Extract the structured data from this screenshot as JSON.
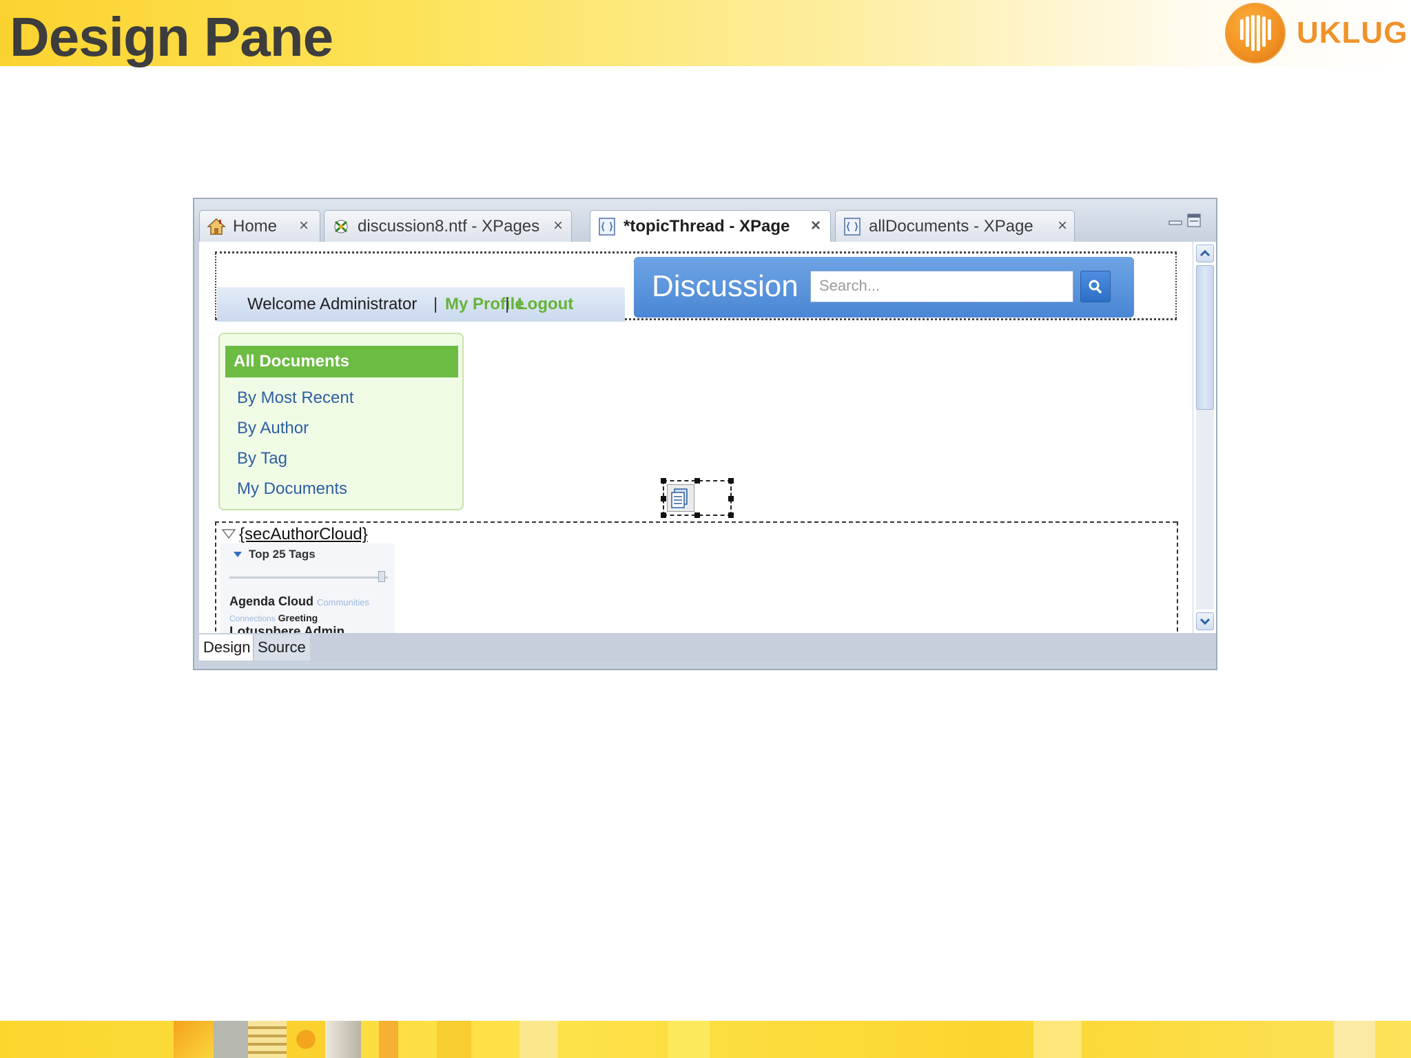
{
  "slide": {
    "title": "Design Pane",
    "logo_text": "UKLUG",
    "brand_color": "#f0922a"
  },
  "editor": {
    "tabs": [
      {
        "label": "Home",
        "icon": "home-icon",
        "active": false
      },
      {
        "label": "discussion8.ntf - XPages",
        "icon": "xpages-app-icon",
        "active": false
      },
      {
        "label": "*topicThread - XPage",
        "icon": "xpage-icon",
        "active": true
      },
      {
        "label": "allDocuments - XPage",
        "icon": "xpage-icon",
        "active": false
      }
    ],
    "close_glyph": "×",
    "bottom_tabs": {
      "design": "Design",
      "source": "Source"
    }
  },
  "design": {
    "welcome": {
      "text": "Welcome Administrator",
      "separator": "|",
      "my_profile": "My Profile",
      "logout": "Logout",
      "link_color": "#66b236"
    },
    "discussion": {
      "title": "Discussion",
      "search_placeholder": "Search...",
      "header_color": "#4a86d4"
    },
    "nav": {
      "header": "All Documents",
      "items": [
        "By Most Recent",
        "By Author",
        "By Tag",
        "My Documents"
      ],
      "header_color": "#6cbb43"
    },
    "section": {
      "label": "{secAuthorCloud}"
    },
    "tag_cloud": {
      "heading": "Top 25 Tags",
      "line1": {
        "strong": "Agenda Cloud",
        "faint": "Communities"
      },
      "line2": {
        "faint": "Connections",
        "strong": "Greeting"
      },
      "line3": {
        "strong": "Lotusphere Admin"
      }
    }
  }
}
